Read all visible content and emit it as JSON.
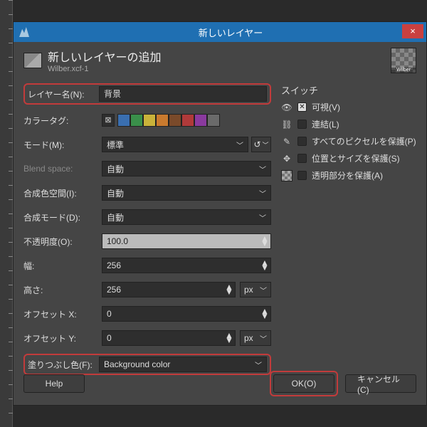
{
  "window": {
    "title": "新しいレイヤー",
    "close": "×"
  },
  "header": {
    "title": "新しいレイヤーの追加",
    "subtitle": "Wilber.xcf-1"
  },
  "left": {
    "layerName": {
      "label": "レイヤー名(N):",
      "value": "背景"
    },
    "colorTag": {
      "label": "カラータグ:"
    },
    "mode": {
      "label": "モード(M):",
      "value": "標準"
    },
    "blendSpace": {
      "label": "Blend space:",
      "value": "自動"
    },
    "compositeSpace": {
      "label": "合成色空間(I):",
      "value": "自動"
    },
    "compositeMode": {
      "label": "合成モード(D):",
      "value": "自動"
    },
    "opacity": {
      "label": "不透明度(O):",
      "value": "100.0"
    },
    "width": {
      "label": "幅:",
      "value": "256"
    },
    "height": {
      "label": "高さ:",
      "value": "256",
      "unit": "px"
    },
    "offsetX": {
      "label": "オフセット X:",
      "value": "0"
    },
    "offsetY": {
      "label": "オフセット Y:",
      "value": "0",
      "unit": "px"
    },
    "fill": {
      "label": "塗りつぶし色(F):",
      "value": "Background color"
    }
  },
  "right": {
    "title": "スイッチ",
    "visible": "可視(V)",
    "linked": "連結(L)",
    "lockPixels": "すべてのピクセルを保護(P)",
    "lockPos": "位置とサイズを保護(S)",
    "lockAlpha": "透明部分を保護(A)"
  },
  "colors": [
    "#3a6fb0",
    "#3a8f4a",
    "#c9b23a",
    "#c97a2e",
    "#7a4a2a",
    "#b03a3a",
    "#8a3a9e",
    "#6a6a6a"
  ],
  "footer": {
    "help": "Help",
    "ok": "OK(O)",
    "cancel": "キャンセル(C)"
  }
}
